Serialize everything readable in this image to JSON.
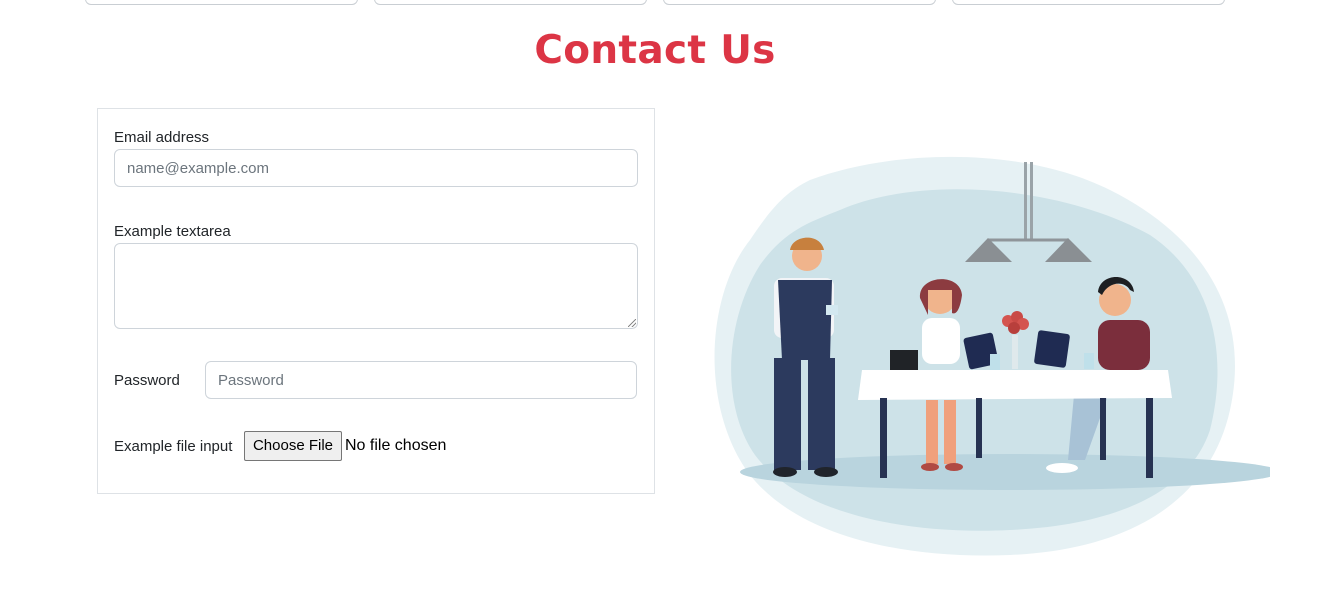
{
  "header": {
    "title": "Contact Us"
  },
  "form": {
    "email_label": "Email address",
    "email_placeholder": "name@example.com",
    "email_value": "",
    "textarea_label": "Example textarea",
    "textarea_value": "",
    "password_label": "Password",
    "password_placeholder": "Password",
    "password_value": "",
    "file_label": "Example file input",
    "file_button": "Choose File",
    "file_status": "No file chosen"
  },
  "colors": {
    "title": "#dc3545",
    "border": "#dee2e6",
    "input_border": "#ced4da",
    "illustration_bg": "#cde2e8",
    "table": "#ffffff",
    "waiter_vest": "#2c3a5e"
  },
  "illustration": {
    "description_icon": "restaurant-scene-illustration"
  }
}
